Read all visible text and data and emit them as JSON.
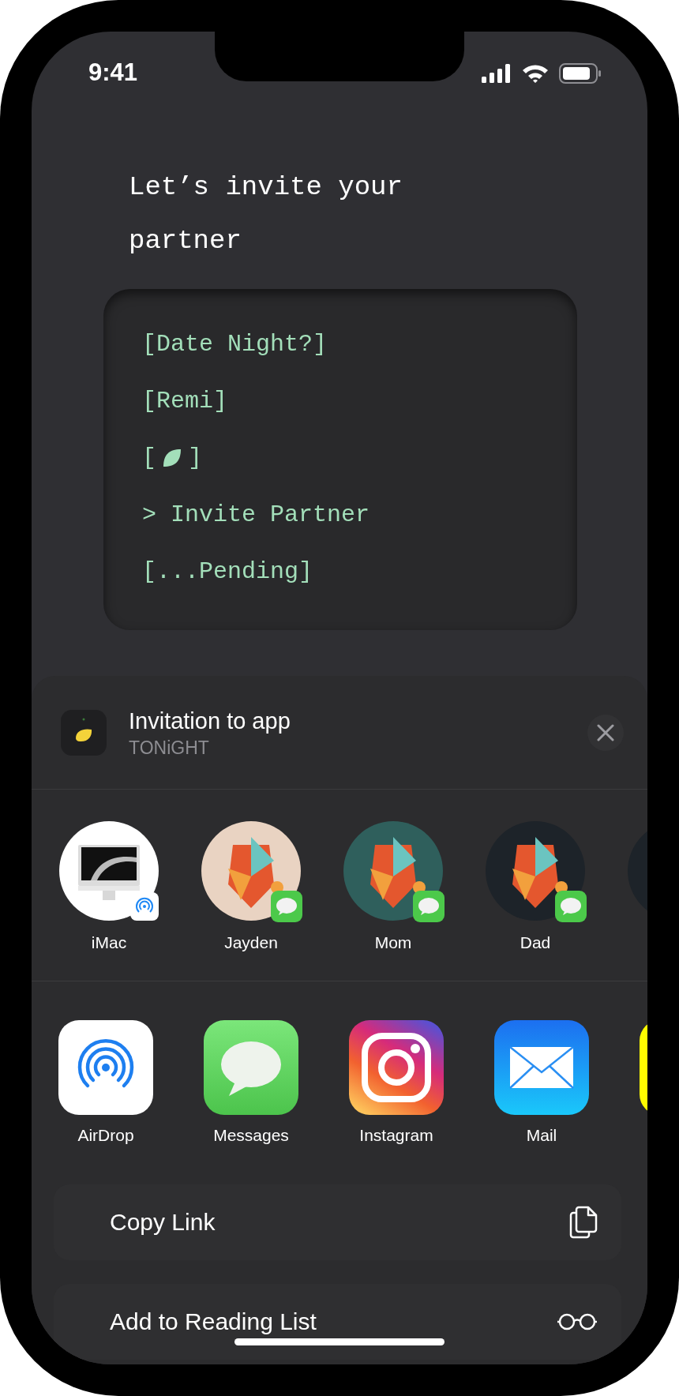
{
  "status_bar": {
    "time": "9:41"
  },
  "heading": "Let’s invite your partner",
  "terminal": {
    "lines": [
      {
        "kind": "text",
        "text": "[Date Night?]"
      },
      {
        "kind": "text",
        "text": "[Remi]"
      },
      {
        "kind": "leaf",
        "open": "[",
        "close": "]"
      },
      {
        "kind": "prompt",
        "prompt": ">",
        "text": "Invite Partner"
      },
      {
        "kind": "text",
        "text": "[...Pending]"
      }
    ]
  },
  "share_sheet": {
    "title": "Invitation to app",
    "subtitle": "TONiGHT",
    "contacts": [
      {
        "kind": "device",
        "name": "iMac",
        "badge": {
          "kind": "airdrop"
        }
      },
      {
        "kind": "person",
        "name": "Jayden",
        "badge": {
          "kind": "messages"
        },
        "color": "#e9d3c2"
      },
      {
        "kind": "person",
        "name": "Mom",
        "badge": {
          "kind": "messages"
        },
        "color": "#2f5f5c"
      },
      {
        "kind": "person",
        "name": "Dad",
        "badge": {
          "kind": "messages"
        },
        "color": "#1d2329"
      },
      {
        "kind": "cut",
        "color": "#1d2329"
      }
    ],
    "apps": [
      {
        "kind": "airdrop",
        "name": "AirDrop"
      },
      {
        "kind": "messages",
        "name": "Messages"
      },
      {
        "kind": "instagram",
        "name": "Instagram"
      },
      {
        "kind": "mail",
        "name": "Mail"
      },
      {
        "kind": "cut"
      }
    ],
    "actions": [
      {
        "kind": "copy",
        "label": "Copy Link"
      },
      {
        "kind": "reading",
        "label": "Add to Reading List"
      }
    ]
  }
}
